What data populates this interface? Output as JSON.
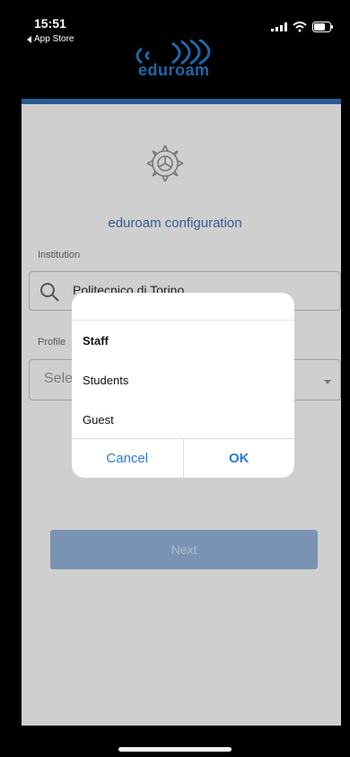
{
  "status_bar": {
    "time": "15:51",
    "back_app_label": "App Store",
    "icons": [
      "signal-icon",
      "wifi-icon",
      "battery-icon"
    ]
  },
  "logo": {
    "text": "eduroam",
    "color": "#1e68a8"
  },
  "form": {
    "title": "eduroam configuration",
    "institution_label": "Institution",
    "institution_value": "Politecnico di Torino",
    "profile_label": "Profile",
    "profile_placeholder": "Sele",
    "next_label": "Next"
  },
  "dialog": {
    "options": [
      "Staff",
      "Students",
      "Guest"
    ],
    "selected_option": "Staff",
    "cancel_label": "Cancel",
    "ok_label": "OK"
  },
  "colors": {
    "accent": "#2c7bd8",
    "brand": "#2a5b94",
    "button_disabled": "#7b93b3"
  }
}
